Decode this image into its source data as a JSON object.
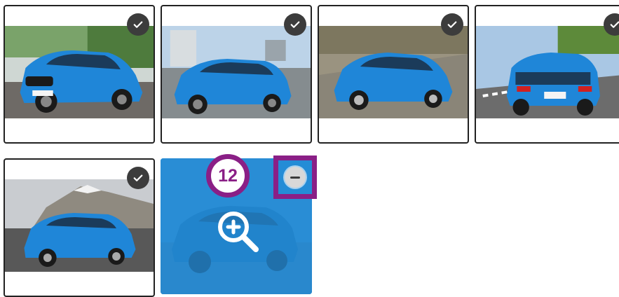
{
  "gallery": {
    "selected_count": "12",
    "cards": [
      {
        "name": "photo-card-1",
        "state": "checked",
        "image": "bmw-x2-front-road"
      },
      {
        "name": "photo-card-2",
        "state": "checked",
        "image": "bmw-x2-city-highway"
      },
      {
        "name": "photo-card-3",
        "state": "checked",
        "image": "bmw-x2-motion-blur"
      },
      {
        "name": "photo-card-4",
        "state": "checked",
        "image": "bmw-x2-rear-track"
      },
      {
        "name": "photo-card-5",
        "state": "checked",
        "image": "bmw-x2-mountain-side"
      },
      {
        "name": "photo-card-6",
        "state": "selected",
        "image": "bmw-x2-selected-preview"
      }
    ],
    "icons": {
      "check": "check-icon",
      "zoom": "zoom-in-icon",
      "remove": "minus-circle-icon"
    },
    "colors": {
      "car_blue": "#1f86d8",
      "highlight": "#8a1f86",
      "overlay_blue": "#2f8fd0",
      "check_bg": "#3c3c3c"
    }
  }
}
